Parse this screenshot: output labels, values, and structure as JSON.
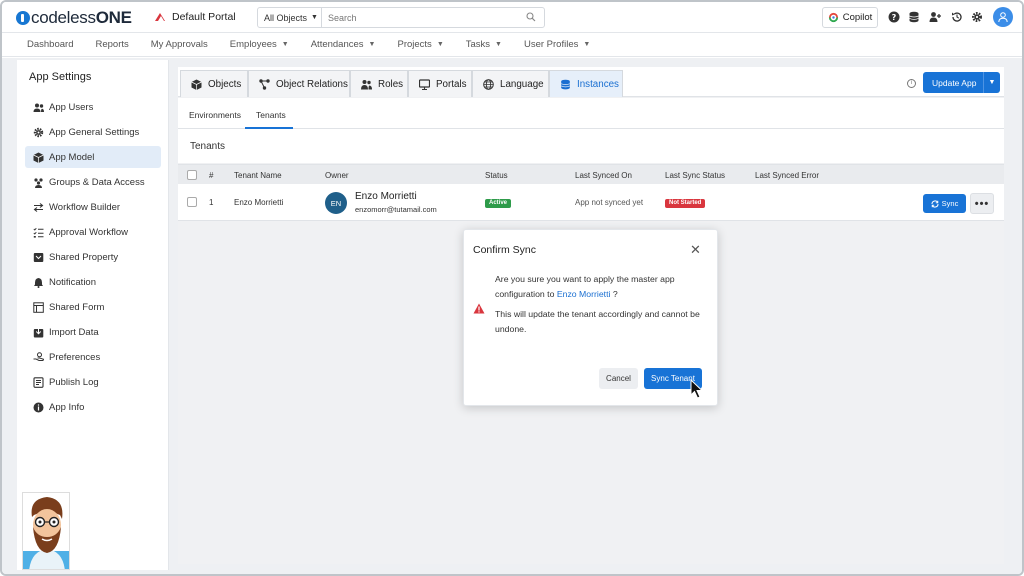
{
  "brand": {
    "logo_bold": "codeless",
    "logo_strong": "ONE",
    "portal": "Default Portal"
  },
  "search": {
    "scope": "All Objects",
    "placeholder": "Search"
  },
  "topbar": {
    "copilot": "Copilot",
    "icons": [
      "help-icon",
      "database-icon",
      "add-user-icon",
      "history-icon",
      "settings-icon",
      "user-avatar-icon"
    ]
  },
  "nav": {
    "items": [
      {
        "label": "Dashboard",
        "dropdown": false
      },
      {
        "label": "Reports",
        "dropdown": false
      },
      {
        "label": "My Approvals",
        "dropdown": false
      },
      {
        "label": "Employees",
        "dropdown": true
      },
      {
        "label": "Attendances",
        "dropdown": true
      },
      {
        "label": "Projects",
        "dropdown": true
      },
      {
        "label": "Tasks",
        "dropdown": true
      },
      {
        "label": "User Profiles",
        "dropdown": true
      }
    ]
  },
  "sidebar": {
    "title": "App Settings",
    "items": [
      {
        "label": "App Users",
        "icon": "users-icon"
      },
      {
        "label": "App General Settings",
        "icon": "gear-icon"
      },
      {
        "label": "App Model",
        "icon": "cube-icon",
        "active": true
      },
      {
        "label": "Groups & Data Access",
        "icon": "group-icon"
      },
      {
        "label": "Workflow Builder",
        "icon": "arrows-icon"
      },
      {
        "label": "Approval Workflow",
        "icon": "checklist-icon"
      },
      {
        "label": "Shared Property",
        "icon": "box-icon"
      },
      {
        "label": "Notification",
        "icon": "bell-icon"
      },
      {
        "label": "Shared Form",
        "icon": "form-icon"
      },
      {
        "label": "Import Data",
        "icon": "import-icon"
      },
      {
        "label": "Preferences",
        "icon": "hand-icon"
      },
      {
        "label": "Publish Log",
        "icon": "log-icon"
      },
      {
        "label": "App Info",
        "icon": "info-icon"
      }
    ]
  },
  "tabs": {
    "items": [
      {
        "label": "Objects",
        "icon": "cube-icon"
      },
      {
        "label": "Object Relations",
        "icon": "relations-icon"
      },
      {
        "label": "Roles",
        "icon": "roles-icon"
      },
      {
        "label": "Portals",
        "icon": "monitor-icon"
      },
      {
        "label": "Language",
        "icon": "globe-icon"
      },
      {
        "label": "Instances",
        "icon": "database-icon",
        "active": true
      }
    ],
    "update_button": "Update App"
  },
  "subtabs": {
    "items": [
      "Environments",
      "Tenants"
    ],
    "active": "Tenants"
  },
  "section": {
    "title": "Tenants"
  },
  "table": {
    "headers": [
      "#",
      "Tenant Name",
      "Owner",
      "Status",
      "Last Synced On",
      "Last Sync Status",
      "Last Synced Error"
    ],
    "rows": [
      {
        "num": "1",
        "tenant_name": "Enzo Morrietti",
        "owner_initials": "EN",
        "owner_name": "Enzo Morrietti",
        "owner_email": "enzomorr@tutamail.com",
        "status": "Active",
        "last_synced_on": "App not synced yet",
        "last_sync_status": "Not Started",
        "last_synced_error": "",
        "sync_button": "Sync",
        "more": "•••"
      }
    ]
  },
  "modal": {
    "title": "Confirm Sync",
    "line1": "Are you sure you want to apply the master app",
    "line2_pre": "configuration to",
    "tenant_link": "Enzo Morrietti",
    "line2_post": "?",
    "warn1": "This will update the tenant accordingly and cannot be",
    "warn2": "undone.",
    "cancel": "Cancel",
    "confirm": "Sync Tenant"
  },
  "colors": {
    "primary": "#1873d6",
    "active_badge": "#2e9b4a",
    "not_started_badge": "#d9363e",
    "warning": "#d9363e"
  }
}
